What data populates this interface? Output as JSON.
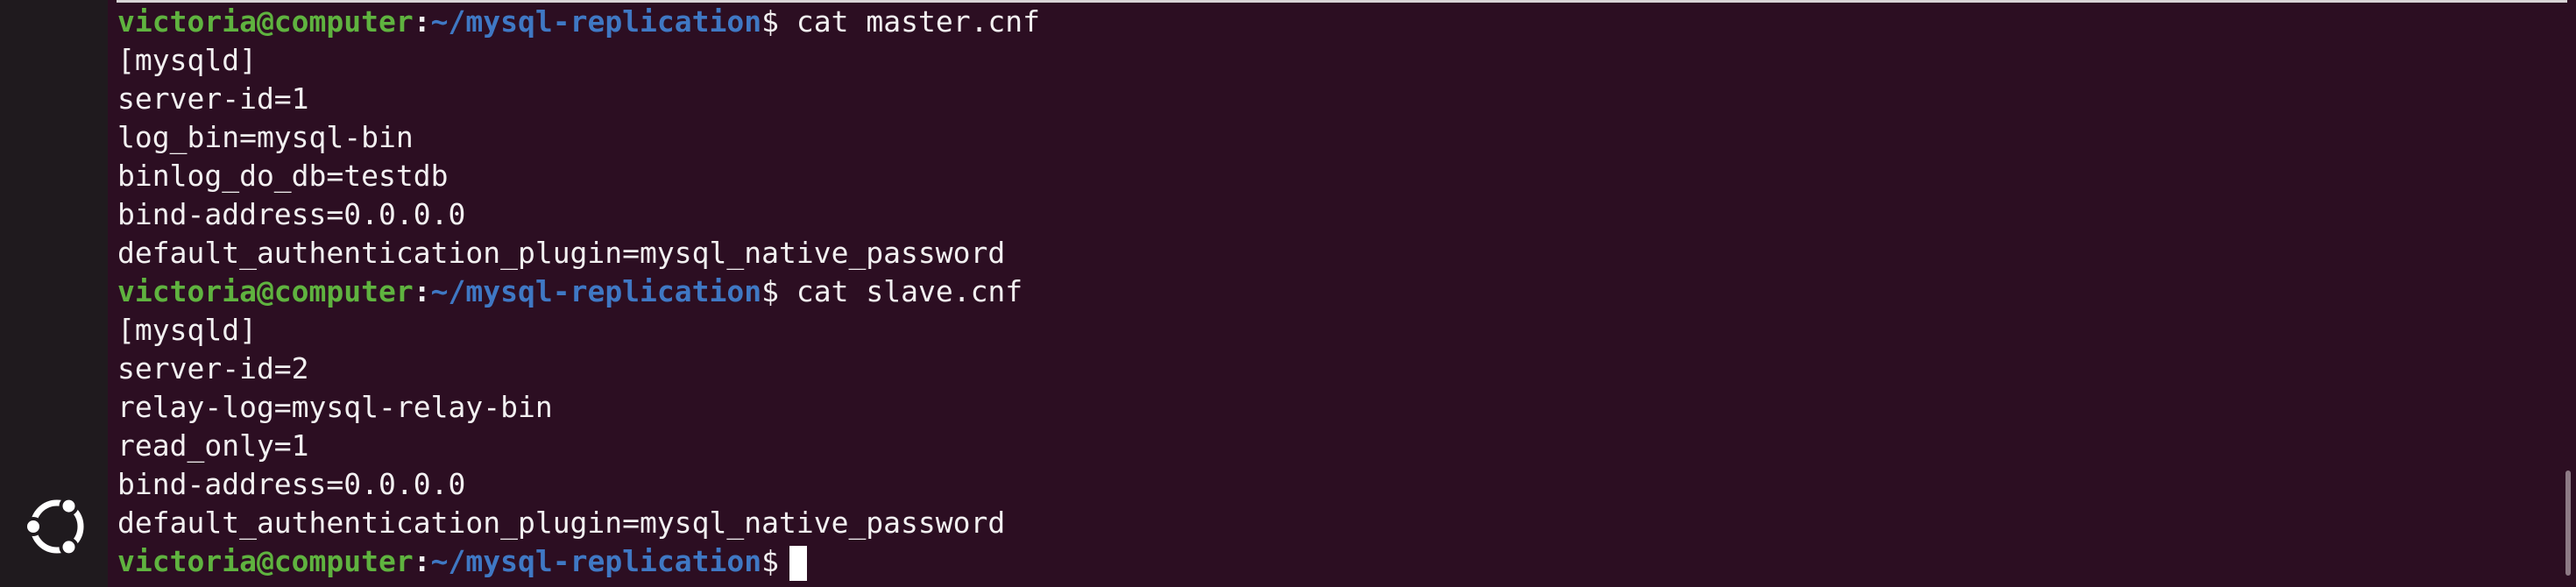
{
  "dock": {
    "apps_icon": "ubuntu-logo-icon"
  },
  "terminal": {
    "prompt": {
      "user_host": "victoria@computer",
      "colon": ":",
      "path": "~/mysql-replication",
      "dollar": "$"
    },
    "commands": {
      "first": "cat master.cnf",
      "second": "cat slave.cnf",
      "third": ""
    },
    "master_cnf": [
      "[mysqld]",
      "server-id=1",
      "log_bin=mysql-bin",
      "binlog_do_db=testdb",
      "bind-address=0.0.0.0",
      "default_authentication_plugin=mysql_native_password"
    ],
    "slave_cnf": [
      "[mysqld]",
      "server-id=2",
      "relay-log=mysql-relay-bin",
      "read_only=1",
      "bind-address=0.0.0.0",
      "default_authentication_plugin=mysql_native_password"
    ]
  },
  "colors": {
    "background": "#2c0e22",
    "prompt_user": "#5fb33f",
    "prompt_path": "#3f78c4",
    "text": "#f2f0f1"
  }
}
